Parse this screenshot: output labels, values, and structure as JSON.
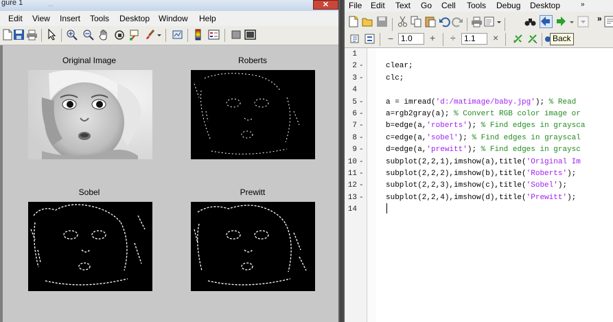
{
  "figure": {
    "title_fragment": "gure 1",
    "faded_title": "...",
    "close_glyph": "✕",
    "menu": [
      "Edit",
      "View",
      "Insert",
      "Tools",
      "Desktop",
      "Window",
      "Help"
    ],
    "toolbar_icons": [
      "new-figure-icon",
      "save-icon",
      "print-icon",
      "edit-plot-arrow-icon",
      "zoom-in-icon",
      "zoom-out-icon",
      "pan-hand-icon",
      "rotate-3d-icon",
      "data-cursor-icon",
      "brush-icon",
      "brush-dropdown-icon",
      "link-plot-icon",
      "insert-colorbar-icon",
      "insert-legend-icon",
      "hide-plot-tools-icon",
      "show-plot-tools-icon"
    ],
    "subplots": [
      {
        "title": "Original Image",
        "kind": "grayscale"
      },
      {
        "title": "Roberts",
        "kind": "edges"
      },
      {
        "title": "Sobel",
        "kind": "edges"
      },
      {
        "title": "Prewitt",
        "kind": "edges"
      }
    ]
  },
  "editor": {
    "menu": [
      "File",
      "Edit",
      "Text",
      "Go",
      "Cell",
      "Tools",
      "Debug",
      "Desktop"
    ],
    "overflow_glyph": "»",
    "toolbar_icons": [
      "new-file-icon",
      "open-icon",
      "save-icon",
      "cut-icon",
      "copy-icon",
      "paste-icon",
      "undo-icon",
      "redo-icon",
      "print-icon",
      "find-binoculars-icon",
      "go-back-icon",
      "go-forward-icon",
      "find-function-icon"
    ],
    "cell_toolbar": {
      "minus": "−",
      "value1": "1.0",
      "plus": "+",
      "divide": "÷",
      "value2": "1.1",
      "times": "×"
    },
    "tooltip": "Back",
    "lines": [
      {
        "num": "1",
        "dash": false,
        "code": ""
      },
      {
        "num": "2",
        "dash": true,
        "code": "clear;"
      },
      {
        "num": "3",
        "dash": true,
        "code": "clc;"
      },
      {
        "num": "4",
        "dash": false,
        "code": ""
      },
      {
        "num": "5",
        "dash": true,
        "segments": [
          [
            "a = imread(",
            ""
          ],
          [
            "'d:/matimage/baby.jpg'",
            "s"
          ],
          [
            "); ",
            ""
          ],
          [
            "% Read",
            "c"
          ]
        ]
      },
      {
        "num": "6",
        "dash": true,
        "segments": [
          [
            "a=rgb2gray(a); ",
            ""
          ],
          [
            "% Convert RGB color image or",
            "c"
          ]
        ]
      },
      {
        "num": "7",
        "dash": true,
        "segments": [
          [
            "b=edge(a,",
            ""
          ],
          [
            "'roberts'",
            "s"
          ],
          [
            "); ",
            ""
          ],
          [
            "% Find edges in graysca",
            "c"
          ]
        ]
      },
      {
        "num": "8",
        "dash": true,
        "segments": [
          [
            "c=edge(a,",
            ""
          ],
          [
            "'sobel'",
            "s"
          ],
          [
            "); ",
            ""
          ],
          [
            "% Find edges in grayscal",
            "c"
          ]
        ]
      },
      {
        "num": "9",
        "dash": true,
        "segments": [
          [
            "d=edge(a,",
            ""
          ],
          [
            "'prewitt'",
            "s"
          ],
          [
            "); ",
            ""
          ],
          [
            "% Find edges in graysc",
            "c"
          ]
        ]
      },
      {
        "num": "10",
        "dash": true,
        "segments": [
          [
            "subplot(2,2,1),imshow(a),title(",
            ""
          ],
          [
            "'Original Im",
            "s"
          ]
        ]
      },
      {
        "num": "11",
        "dash": true,
        "segments": [
          [
            "subplot(2,2,2),imshow(b),title(",
            ""
          ],
          [
            "'Roberts'",
            "s"
          ],
          [
            ");",
            ""
          ]
        ]
      },
      {
        "num": "12",
        "dash": true,
        "segments": [
          [
            "subplot(2,2,3),imshow(c),title(",
            ""
          ],
          [
            "'Sobel'",
            "s"
          ],
          [
            ");",
            ""
          ]
        ]
      },
      {
        "num": "13",
        "dash": true,
        "segments": [
          [
            "subplot(2,2,4),imshow(d),title(",
            ""
          ],
          [
            "'Prewitt'",
            "s"
          ],
          [
            ");",
            ""
          ]
        ]
      },
      {
        "num": "14",
        "dash": false,
        "code": ""
      }
    ]
  },
  "colors": {
    "string": "#a020f0",
    "comment": "#228b22",
    "figure_bg": "#c8c8c8"
  }
}
